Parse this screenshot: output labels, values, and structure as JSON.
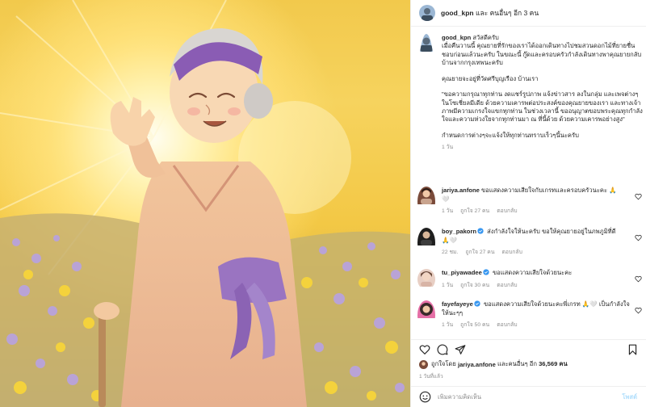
{
  "post": {
    "image_alt": "Illustration of a smiling elderly woman in a kimono waving among flowers in golden light",
    "author": "good_kpn",
    "header_suffix": "และ คนอื่นๆ อีก 3 คน"
  },
  "caption": {
    "username": "good_kpn",
    "first_line": "สวัสดีครับ",
    "para1": "เมื่อคืนวานนี้ คุณยายที่รักของเราได้ออกเดินทางไปชมสวนดอกไม้ที่ยายชื่นชอบก่อนแล้วนะครับ ในขณะนี้ กู๊ดและครอบครัวกำลังเดินทางพาคุณยายกลับบ้านจากกรุงเทพนะครับ",
    "para2": "คุณยายจะอยู่ที่วัดศรีบุญเรือง บ้านเรา",
    "para3": "\"ขอความกรุณาทุกท่าน งดแชร์รูปภาพ แจ้งข่าวสาร ลงในกลุ่ม และเพจต่างๆในโซเชี่ยลมีเดีย ด้วยความเคารพต่อประสงค์ของคุณยายของเรา และทางเจ้าภาพมีความเกรงใจแขกทุกท่าน ในช่วงเวลานี้ ขออนุญาตขอบพระคุณทุกกำลังใจและความห่วงใยจากทุกท่านมา ณ ที่นี้ด้วย ด้วยความเคารพอย่างสูง\"",
    "para4": "กำหนดการต่างๆจะแจ้งให้ทุกท่านทราบเร็วๆนี้นะครับ",
    "time": "1 วัน"
  },
  "comments": [
    {
      "username": "jariya.anfone",
      "verified": false,
      "text": "ขอแสดงความเสียใจกับเกรทและครอบครัวนะคะ 🙏",
      "extra": "🤍",
      "time": "1 วัน",
      "likes": "ถูกใจ 27 คน",
      "reply": "ตอบกลับ",
      "avatar_color": "#7a4b3a"
    },
    {
      "username": "boy_pakorn",
      "verified": true,
      "text": "ส่งกำลังใจให้นะครับ ขอให้คุณยายอยู่ในภพภูมิที่ดี",
      "extra": "🙏🤍",
      "time": "22 ชม.",
      "likes": "ถูกใจ 27 คน",
      "reply": "ตอบกลับ",
      "avatar_color": "#1e1e1e"
    },
    {
      "username": "tu_piyawadee",
      "verified": true,
      "text": "ขอแสดงความเสียใจด้วยนะคะ",
      "extra": "",
      "time": "1 วัน",
      "likes": "ถูกใจ 30 คน",
      "reply": "ตอบกลับ",
      "avatar_color": "#d8b4a6"
    },
    {
      "username": "fayefayeye",
      "verified": true,
      "text": "ขอแสดงความเสียใจด้วยนะคะพี่เกรท 🙏🤍 เป็นกำลังใจให้นะๆๆ",
      "extra": "",
      "time": "1 วัน",
      "likes": "ถูกใจ 50 คน",
      "reply": "ตอบกลับ",
      "avatar_color": "#3a2a2a"
    }
  ],
  "likes": {
    "prefix": "ถูกใจโดย",
    "user": "jariya.anfone",
    "middle": "และคนอื่นๆ อีก",
    "count": "36,569 คน"
  },
  "post_time": "1 วันที่แล้ว",
  "comment_box": {
    "placeholder": "เพิ่มความคิดเห็น",
    "post_label": "โพสต์"
  },
  "colors": {
    "verified": "#3897f0",
    "post_button": "#b2dffc",
    "muted_text": "#8e8e8e"
  }
}
